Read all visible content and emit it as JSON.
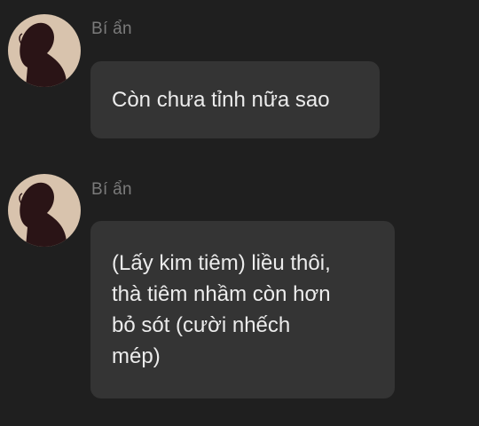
{
  "messages": [
    {
      "sender": "Bí ẩn",
      "avatar_icon": "silhouette-avatar-icon",
      "text": "Còn chưa tỉnh nữa sao"
    },
    {
      "sender": "Bí ẩn",
      "avatar_icon": "silhouette-avatar-icon",
      "text": "(Lấy kim tiêm) liều thôi,\nthà tiêm nhầm còn hơn\nbỏ sót (cười nhếch\nmép)"
    }
  ],
  "colors": {
    "background": "#1f1f1f",
    "bubble": "#343434",
    "sender": "#7b7b7b",
    "text": "#ececec",
    "avatar_bg": "#d8c3ad",
    "avatar_figure": "#2a1416"
  }
}
